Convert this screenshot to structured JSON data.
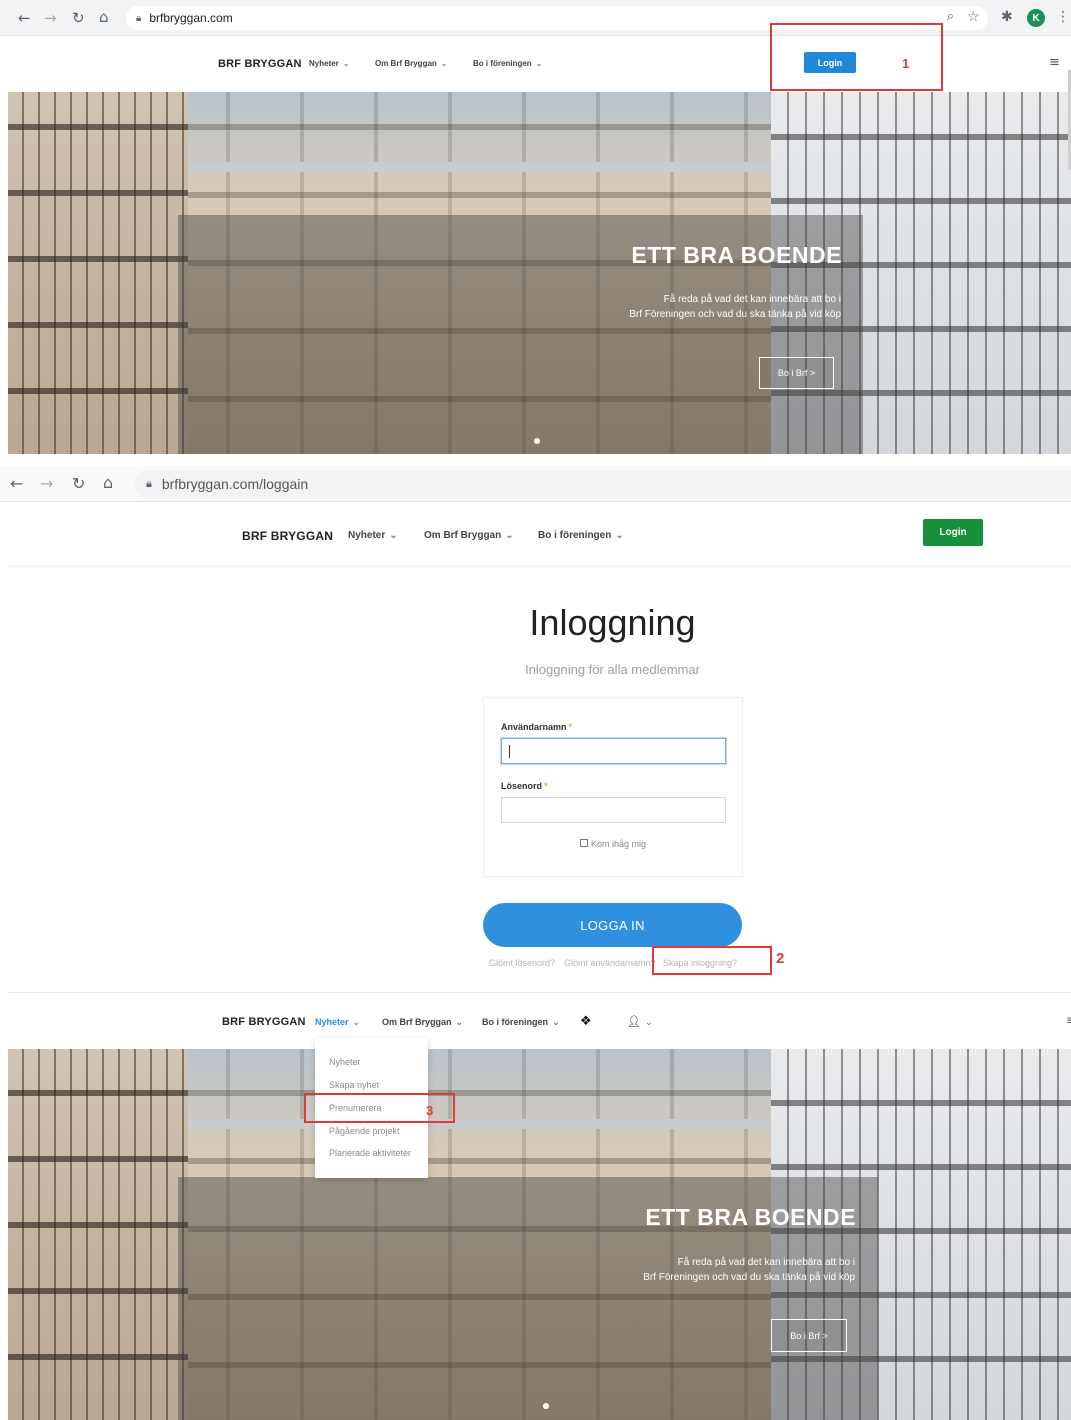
{
  "section1": {
    "url": "brfbryggan.com",
    "avatar_letter": "K",
    "brand": "BRF BRYGGAN",
    "nav": [
      "Nyheter",
      "Om Brf Bryggan",
      "Bo i föreningen"
    ],
    "login_label": "Login",
    "annotation": "1",
    "hero": {
      "title": "ETT BRA BOENDE",
      "text_line1": "Få reda på vad det kan innebära att bo i",
      "text_line2": "Brf Föreningen och vad du ska tänka på vid köp",
      "button": "Bo i Brf >"
    }
  },
  "section2": {
    "url": "brfbryggan.com/loggain",
    "brand": "BRF BRYGGAN",
    "nav": [
      "Nyheter",
      "Om Brf Bryggan",
      "Bo i föreningen"
    ],
    "login_label": "Login",
    "title": "Inloggning",
    "subtitle": "Inloggning för alla medlemmar",
    "username_label": "Användarnamn",
    "password_label": "Lösenord",
    "required_mark": "*",
    "remember_label": "Kom ihåg mig",
    "submit_label": "LOGGA IN",
    "links": [
      "Glömt lösenord?",
      "Glömt användarnamn?",
      "Skapa inloggning?"
    ],
    "annotation": "2"
  },
  "section3": {
    "brand": "BRF BRYGGAN",
    "nav": [
      "Nyheter",
      "Om Brf Bryggan",
      "Bo i föreningen"
    ],
    "dropdown": [
      "Nyheter",
      "Skapa nyhet",
      "Prenumerera",
      "Pågående projekt",
      "Planerade aktiviteter"
    ],
    "annotation": "3",
    "hero": {
      "title": "ETT BRA BOENDE",
      "text_line1": "Få reda på vad det kan innebära att bo i",
      "text_line2": "Brf Föreningen och vad du ska tänka på vid köp",
      "button": "Bo i Brf >"
    }
  },
  "colors": {
    "login_blue": "#1f88d9",
    "login_green": "#18913d",
    "submit_blue": "#2f90e0",
    "annotation_red": "#e03a3a",
    "active_nav": "#2f90e0"
  }
}
